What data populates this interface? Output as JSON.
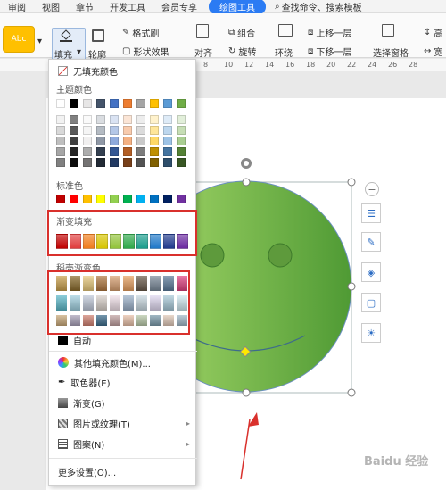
{
  "tabs": [
    "审阅",
    "视图",
    "章节",
    "开发工具",
    "会员专享"
  ],
  "active_tab": "绘图工具",
  "search_label": "查找命令、搜索模板",
  "ribbon": {
    "style_preview": "Abc",
    "fill": "填充",
    "outline": "轮廓",
    "format_brush": "格式刷",
    "shape_effect": "形状效果",
    "align": "对齐",
    "group": "组合",
    "rotate": "旋转",
    "wrap": "环绕",
    "bring_forward": "上移一层",
    "send_backward": "下移一层",
    "selection_pane": "选择窗格",
    "height": "高",
    "width": "宽"
  },
  "ruler_numbers": [
    "8",
    "10",
    "12",
    "14",
    "16",
    "18",
    "20",
    "22",
    "24",
    "26",
    "28"
  ],
  "menu": {
    "no_fill": "无填充颜色",
    "theme_colors": "主题颜色",
    "standard_colors": "标准色",
    "gradient_fill": "渐变填充",
    "docer_gradient": "稻壳渐变色",
    "auto": "自动",
    "more_colors": "其他填充颜色(M)...",
    "eyedropper": "取色器(E)",
    "gradient": "渐变(G)",
    "picture_texture": "图片或纹理(T)",
    "pattern": "图案(N)",
    "more_settings": "更多设置(O)..."
  },
  "colors": {
    "theme_top": [
      "#ffffff",
      "#000000",
      "#e7e6e6",
      "#44546a",
      "#4472c4",
      "#ed7d31",
      "#a5a5a5",
      "#ffc000",
      "#5b9bd5",
      "#70ad47"
    ],
    "standard": [
      "#c00000",
      "#ff0000",
      "#ffc000",
      "#ffff00",
      "#92d050",
      "#00b050",
      "#00b0f0",
      "#0070c0",
      "#002060",
      "#7030a0"
    ],
    "gradient_fill": [
      "#c00000",
      "#e03c3c",
      "#f07c1c",
      "#d6c400",
      "#92c33a",
      "#2ea84a",
      "#1a9c8c",
      "#1f78c8",
      "#203a8c",
      "#6a2aa0"
    ],
    "shape_fill": "#8dc63f",
    "accent": "#2b7bf3",
    "highlight_border": "#d9302c"
  },
  "watermark": "Baidu 经验"
}
